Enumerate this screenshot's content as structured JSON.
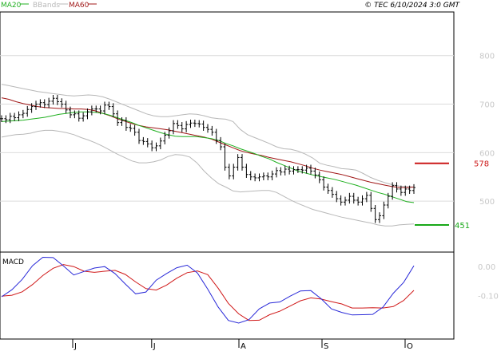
{
  "header": {
    "legend": [
      {
        "label": "MA20",
        "color": "#20b020"
      },
      {
        "label": "BBands",
        "color": "#b8b8b8"
      },
      {
        "label": "MA60",
        "color": "#a01818"
      }
    ],
    "copyright": "© TEC 6/10/2024 3:0 GMT"
  },
  "colors": {
    "price": "#000000",
    "ma20": "#20b020",
    "ma60": "#a01818",
    "bbands": "#b8b8b8",
    "grid": "#dcdcdc",
    "macd": "#2828d8",
    "signal": "#d01818"
  },
  "chart_data": [
    {
      "type": "line",
      "panel": "price",
      "y_ticks": [
        500,
        600,
        700,
        800
      ],
      "y_tick_labels": [
        "500",
        "600",
        "700",
        "800"
      ],
      "ylim": [
        395,
        890
      ],
      "x_months": [
        "J",
        "J",
        "A",
        "S",
        "O"
      ],
      "x_month_positions": [
        35,
        73,
        115,
        155,
        195
      ],
      "x_range": [
        0,
        200
      ],
      "series": [
        {
          "key": "price",
          "style": "ohlc",
          "values": [
            670,
            668,
            675,
            672,
            678,
            681,
            689,
            695,
            700,
            703,
            699,
            706,
            712,
            705,
            700,
            688,
            678,
            680,
            671,
            676,
            684,
            690,
            690,
            686,
            698,
            695,
            680,
            662,
            666,
            652,
            650,
            642,
            625,
            623,
            618,
            610,
            614,
            624,
            636,
            645,
            660,
            656,
            649,
            658,
            661,
            660,
            659,
            652,
            648,
            642,
            625,
            612,
            570,
            552,
            570,
            590,
            570,
            555,
            550,
            548,
            550,
            552,
            550,
            556,
            563,
            560,
            566,
            562,
            565,
            565,
            564,
            568,
            562,
            554,
            544,
            529,
            522,
            514,
            505,
            498,
            502,
            510,
            502,
            498,
            505,
            512,
            485,
            462,
            470,
            492,
            510,
            532,
            525,
            518,
            525,
            522,
            528
          ]
        },
        {
          "key": "ma20",
          "name": "MA20",
          "values": [
            664,
            665,
            666,
            667,
            669,
            671,
            673,
            676,
            679,
            681,
            683,
            684,
            684,
            683,
            681,
            677,
            672,
            667,
            662,
            656,
            651,
            646,
            641,
            637,
            634,
            633,
            633,
            633,
            631,
            629,
            625,
            619,
            614,
            608,
            603,
            598,
            592,
            587,
            580,
            574,
            568,
            562,
            558,
            554,
            551,
            548,
            545,
            541,
            537,
            533,
            528,
            523,
            518,
            514,
            509,
            504,
            499,
            497
          ]
        },
        {
          "key": "ma60",
          "name": "MA60",
          "values": [
            713,
            710,
            705,
            701,
            698,
            695,
            693,
            692,
            691,
            691,
            690,
            690,
            689,
            686,
            681,
            676,
            670,
            665,
            660,
            656,
            653,
            651,
            649,
            647,
            644,
            641,
            638,
            635,
            632,
            628,
            622,
            616,
            610,
            604,
            600,
            597,
            594,
            590,
            587,
            584,
            581,
            577,
            573,
            568,
            564,
            561,
            558,
            555,
            551,
            547,
            543,
            539,
            536,
            533,
            530,
            528,
            528,
            529
          ]
        },
        {
          "key": "bb_upper",
          "name": "BBands",
          "values": [
            741,
            738,
            735,
            732,
            729,
            726,
            724,
            722,
            720,
            718,
            717,
            718,
            719,
            718,
            715,
            710,
            704,
            698,
            692,
            686,
            680,
            676,
            674,
            674,
            676,
            678,
            680,
            679,
            676,
            672,
            670,
            669,
            664,
            648,
            637,
            631,
            625,
            619,
            612,
            608,
            607,
            603,
            597,
            589,
            578,
            574,
            571,
            567,
            566,
            564,
            557,
            549,
            543,
            538,
            534,
            531,
            530,
            529
          ]
        },
        {
          "key": "bb_lower",
          "name": "BBands",
          "values": [
            632,
            635,
            637,
            638,
            640,
            644,
            646,
            646,
            644,
            641,
            637,
            631,
            626,
            620,
            613,
            605,
            597,
            590,
            583,
            579,
            579,
            581,
            585,
            592,
            596,
            595,
            591,
            579,
            562,
            548,
            536,
            529,
            521,
            519,
            520,
            521,
            522,
            522,
            518,
            510,
            502,
            495,
            489,
            483,
            479,
            475,
            471,
            467,
            464,
            461,
            458,
            455,
            451,
            449,
            449,
            451,
            452,
            453
          ]
        }
      ],
      "markers": [
        {
          "label": "578",
          "value": 578,
          "color": "#cc1818"
        },
        {
          "label": "451",
          "value": 451,
          "color": "#18a818"
        }
      ]
    },
    {
      "type": "line",
      "panel": "macd",
      "title": "MACD",
      "y_ticks": [
        0,
        -10
      ],
      "y_tick_labels": [
        "0.00",
        "-0.10"
      ],
      "ylim": [
        -25,
        5
      ],
      "x_range": [
        0,
        200
      ],
      "series": [
        {
          "key": "macd",
          "values": [
            -10.4,
            -8.0,
            -4.4,
            0.3,
            3.2,
            3.1,
            0.2,
            -2.9,
            -1.7,
            -0.5,
            0.0,
            -2.4,
            -6.0,
            -9.4,
            -8.8,
            -4.7,
            -2.4,
            -0.4,
            0.5,
            -2.2,
            -7.8,
            -13.9,
            -18.6,
            -19.5,
            -18.3,
            -14.6,
            -12.6,
            -12.2,
            -10.2,
            -8.4,
            -8.3,
            -11.1,
            -14.6,
            -15.8,
            -16.7,
            -16.6,
            -16.5,
            -14.0,
            -9.2,
            -5.5,
            0.3
          ]
        },
        {
          "key": "signal",
          "values": [
            -10.2,
            -9.9,
            -8.7,
            -6.2,
            -3.1,
            -0.6,
            0.7,
            0.0,
            -1.6,
            -2.0,
            -1.6,
            -1.3,
            -2.7,
            -5.3,
            -7.6,
            -8.1,
            -6.4,
            -4.0,
            -2.1,
            -1.5,
            -2.8,
            -7.4,
            -12.7,
            -16.3,
            -18.6,
            -18.5,
            -16.6,
            -15.4,
            -13.6,
            -11.8,
            -10.8,
            -11.2,
            -12.1,
            -12.9,
            -14.3,
            -14.3,
            -14.2,
            -14.3,
            -13.8,
            -11.7,
            -8.2
          ]
        }
      ]
    }
  ]
}
